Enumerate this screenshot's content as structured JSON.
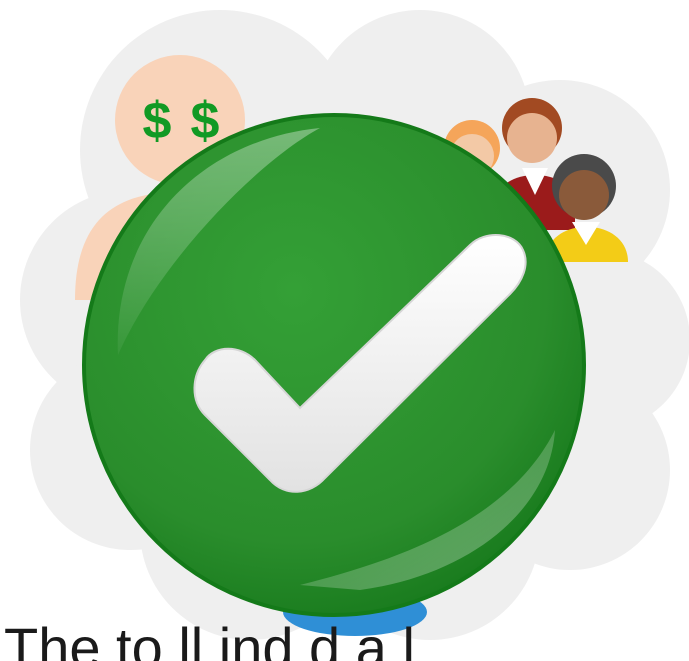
{
  "dollar_symbols": [
    "$",
    "$"
  ],
  "caption": "The           to  ll          ind      d        a     l",
  "colors": {
    "cloud": "#eeeeee",
    "check_circle": "#2c9230",
    "check_circle_dark": "#157d1a",
    "checkmark": "#f4f4f4",
    "dollar_green": "#119a24",
    "payer_skin": "#f9d3b9",
    "blue_shape": "#2f8fd6"
  },
  "icons": {
    "main": "check-circle-icon",
    "payer": "person-with-money-icon",
    "group": "people-group-icon"
  }
}
